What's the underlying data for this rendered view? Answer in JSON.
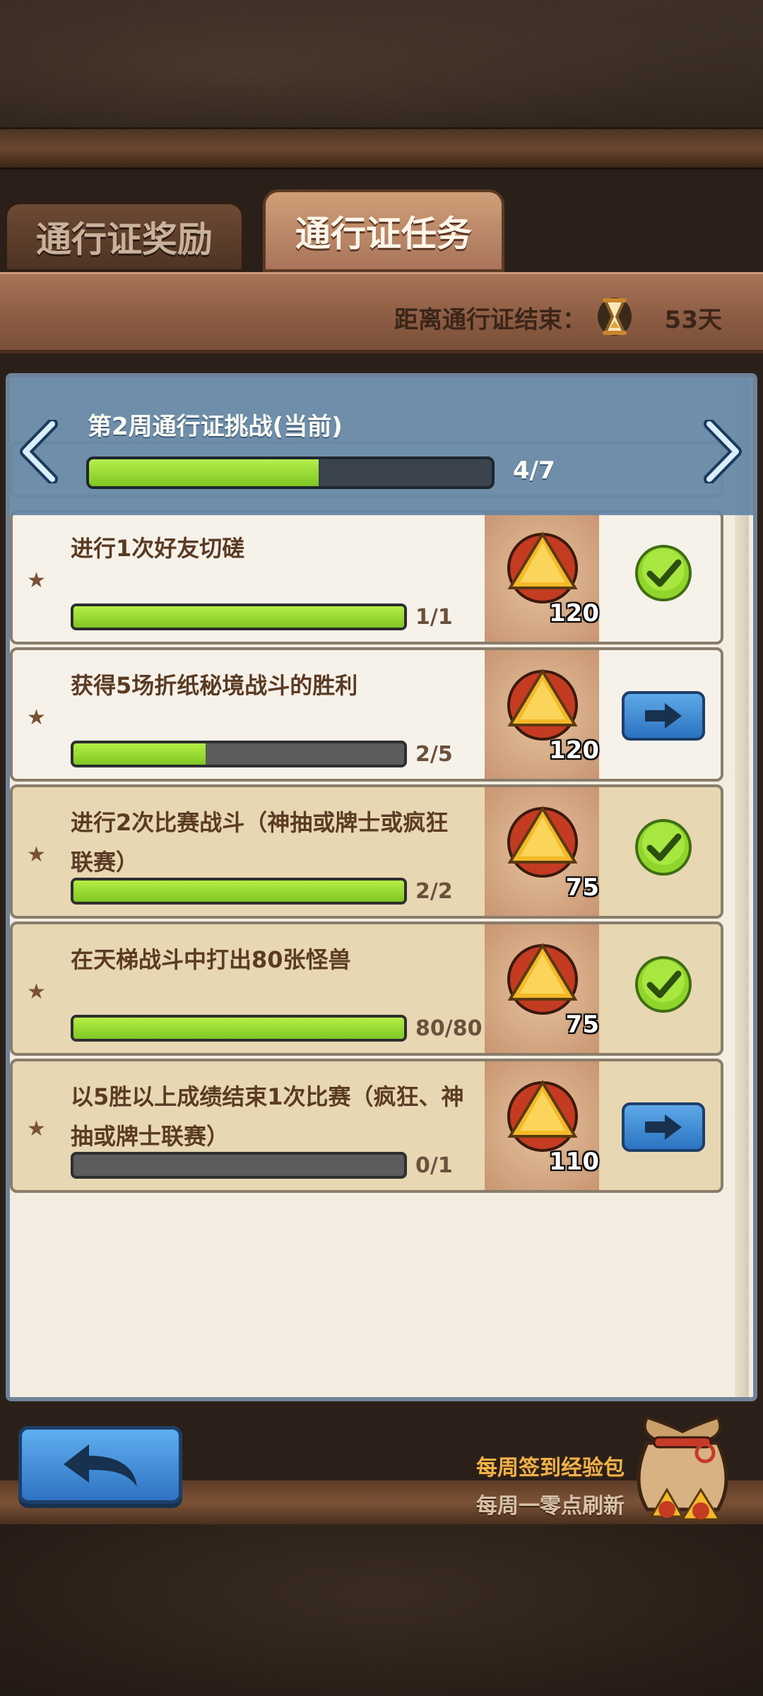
{
  "tabs": {
    "rewards": "通行证奖励",
    "tasks": "通行证任务"
  },
  "countdown": {
    "label": "距离通行证结束：",
    "value": "53天"
  },
  "week": {
    "title": "第2周通行证挑战(当前)",
    "progress": 0.57,
    "count": "4/7"
  },
  "tasks": [
    {
      "desc": "进行1次好友切磋",
      "progress": 1.0,
      "count": "1/1",
      "reward": "120",
      "status": "completed",
      "style": "done"
    },
    {
      "desc": "获得5场折纸秘境战斗的胜利",
      "progress": 0.4,
      "count": "2/5",
      "reward": "120",
      "status": "go",
      "style": "done"
    },
    {
      "desc": "进行2次比赛战斗（神抽或牌士或疯狂联赛）",
      "progress": 1.0,
      "count": "2/2",
      "reward": "75",
      "status": "completed",
      "style": "alt"
    },
    {
      "desc": "在天梯战斗中打出80张怪兽",
      "progress": 1.0,
      "count": "80/80",
      "reward": "75",
      "status": "completed",
      "style": "alt"
    },
    {
      "desc": "以5胜以上成绩结束1次比赛（疯狂、神抽或牌士联赛）",
      "progress": 0.0,
      "count": "0/1",
      "reward": "110",
      "status": "go",
      "style": "alt"
    }
  ],
  "weekly_pack": {
    "title": "每周签到经验包",
    "subtitle": "每周一零点刷新"
  },
  "colors": {
    "progress_fill": "#9ddc35",
    "panel_header": "#6386a5",
    "button_blue": "#3a86d4"
  }
}
